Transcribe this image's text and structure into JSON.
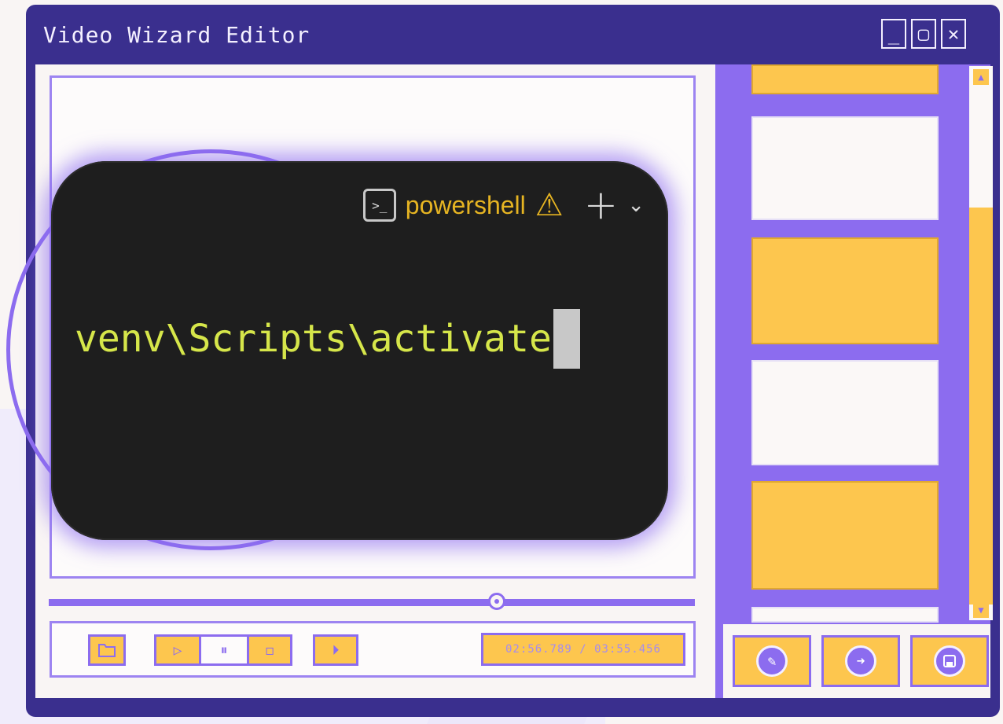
{
  "window": {
    "title": "Video Wizard Editor",
    "buttons": {
      "minimize": "_",
      "maximize": "▢",
      "close": "✕"
    }
  },
  "playback": {
    "time_display": "02:56.789 / 03:55.456",
    "buttons": {
      "open": "folder-icon",
      "play": "▷",
      "pause": "⏸",
      "stop": "◻",
      "next_frame": "⏵"
    }
  },
  "terminal": {
    "shell_label": "powershell",
    "shell_icon": ">_",
    "warning_icon": "⚠",
    "add_icon": "+",
    "dropdown_icon": "⌄",
    "command": "venv\\Scripts\\activate"
  },
  "side_panel": {
    "scroll_up": "▲",
    "scroll_down": "▼",
    "actions": {
      "edit": "✎",
      "export": "➜",
      "save": "💾"
    }
  },
  "colors": {
    "frame": "#3a2f8e",
    "accent": "#8c6cef",
    "yellow": "#fdc64e",
    "terminal_bg": "#1e1e1e",
    "command_text": "#d6e64a"
  }
}
